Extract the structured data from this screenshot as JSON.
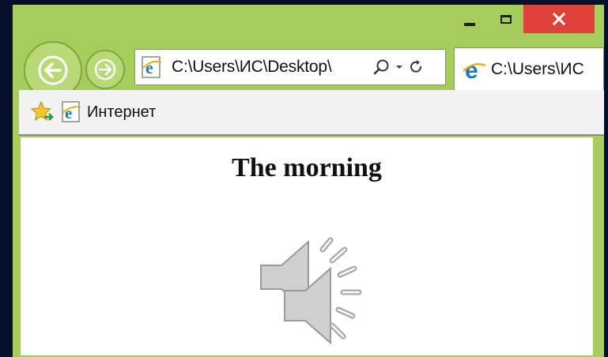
{
  "window": {
    "minimize_icon": "minimize-icon",
    "maximize_icon": "maximize-icon",
    "close_icon": "close-icon",
    "close_color": "#e0403a",
    "frame_color": "#a6cc5c"
  },
  "nav": {
    "back_icon": "arrow-left-icon",
    "forward_icon": "arrow-right-icon"
  },
  "address_bar": {
    "value": "C:\\Users\\ИС\\Desktop\\",
    "search_icon": "search-icon",
    "dropdown_icon": "chevron-down-icon",
    "refresh_icon": "refresh-icon"
  },
  "tab": {
    "label": "C:\\Users\\ИС"
  },
  "favorites_bar": {
    "favorites_icon": "star-icon",
    "item_label": "Интернет"
  },
  "page": {
    "heading": "The morning",
    "overlay_icon": "speaker-icon"
  }
}
